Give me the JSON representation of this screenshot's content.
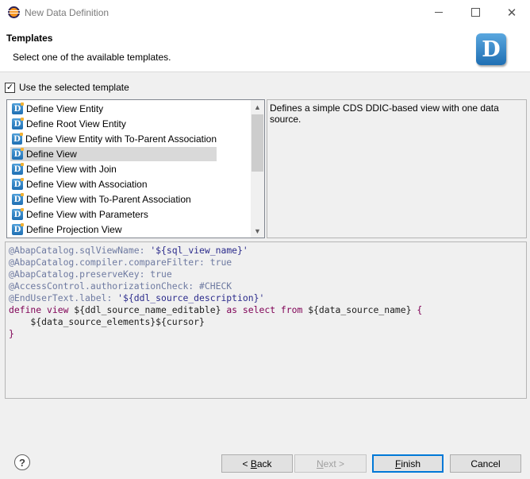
{
  "window": {
    "title": "New Data Definition",
    "minimize_icon": "minimize-icon",
    "maximize_icon": "maximize-icon",
    "close_glyph": "✕"
  },
  "header": {
    "title": "Templates",
    "description": "Select one of the available templates.",
    "badge_letter": "D"
  },
  "use_template": {
    "label": "Use the selected template",
    "checked": true,
    "check_glyph": "✓"
  },
  "templates": {
    "items": [
      {
        "label": "Define View Entity"
      },
      {
        "label": "Define Root View Entity"
      },
      {
        "label": "Define View Entity with To-Parent Association"
      },
      {
        "label": "Define View",
        "selected": true
      },
      {
        "label": "Define View with Join"
      },
      {
        "label": "Define View with Association"
      },
      {
        "label": "Define View with To-Parent Association"
      },
      {
        "label": "Define View with Parameters"
      },
      {
        "label": "Define Projection View"
      }
    ],
    "item_icon_letter": "D",
    "scroll_up_glyph": "▲",
    "scroll_down_glyph": "▼"
  },
  "description_panel": {
    "text": "Defines a simple CDS DDIC-based view with one data source."
  },
  "code": {
    "lines": [
      [
        {
          "cls": "anno",
          "t": "@AbapCatalog.sqlViewName: "
        },
        {
          "cls": "txt",
          "t": "'${sql_view_name}'"
        }
      ],
      [
        {
          "cls": "anno",
          "t": "@AbapCatalog.compiler.compareFilter: true"
        }
      ],
      [
        {
          "cls": "anno",
          "t": "@AbapCatalog.preserveKey: true"
        }
      ],
      [
        {
          "cls": "anno",
          "t": "@AccessControl.authorizationCheck: #CHECK"
        }
      ],
      [
        {
          "cls": "anno",
          "t": "@EndUserText.label: "
        },
        {
          "cls": "txt",
          "t": "'${ddl_source_description}'"
        }
      ],
      [
        {
          "cls": "kw",
          "t": "define view "
        },
        {
          "cls": "plain",
          "t": "${ddl_source_name_editable} "
        },
        {
          "cls": "kw",
          "t": "as select from "
        },
        {
          "cls": "plain",
          "t": "${data_source_name} "
        },
        {
          "cls": "kw",
          "t": "{"
        }
      ],
      [
        {
          "cls": "plain",
          "t": "    ${data_source_elements}${cursor}"
        }
      ],
      [
        {
          "cls": "kw",
          "t": "}"
        }
      ]
    ]
  },
  "buttons": {
    "help_glyph": "?",
    "back_prefix": "< ",
    "back_mnemonic": "B",
    "back_rest": "ack",
    "next_mnemonic": "N",
    "next_rest": "ext >",
    "finish_mnemonic": "F",
    "finish_rest": "inish",
    "cancel": "Cancel"
  }
}
